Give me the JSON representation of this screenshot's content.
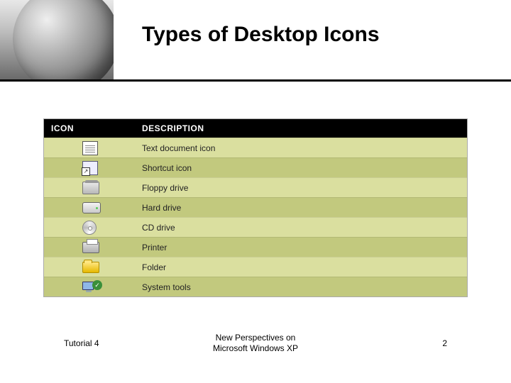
{
  "title": "Types of Desktop Icons",
  "table": {
    "headers": {
      "icon": "ICON",
      "description": "DESCRIPTION"
    },
    "rows": [
      {
        "icon": "text",
        "desc": "Text document icon"
      },
      {
        "icon": "shortcut",
        "desc": "Shortcut icon"
      },
      {
        "icon": "floppy",
        "desc": "Floppy drive"
      },
      {
        "icon": "hdd",
        "desc": "Hard drive"
      },
      {
        "icon": "cd",
        "desc": "CD drive"
      },
      {
        "icon": "printer",
        "desc": "Printer"
      },
      {
        "icon": "folder",
        "desc": "Folder"
      },
      {
        "icon": "systools",
        "desc": "System tools"
      }
    ]
  },
  "footer": {
    "left": "Tutorial 4",
    "center_line1": "New Perspectives on",
    "center_line2": "Microsoft Windows XP",
    "page": "2"
  }
}
